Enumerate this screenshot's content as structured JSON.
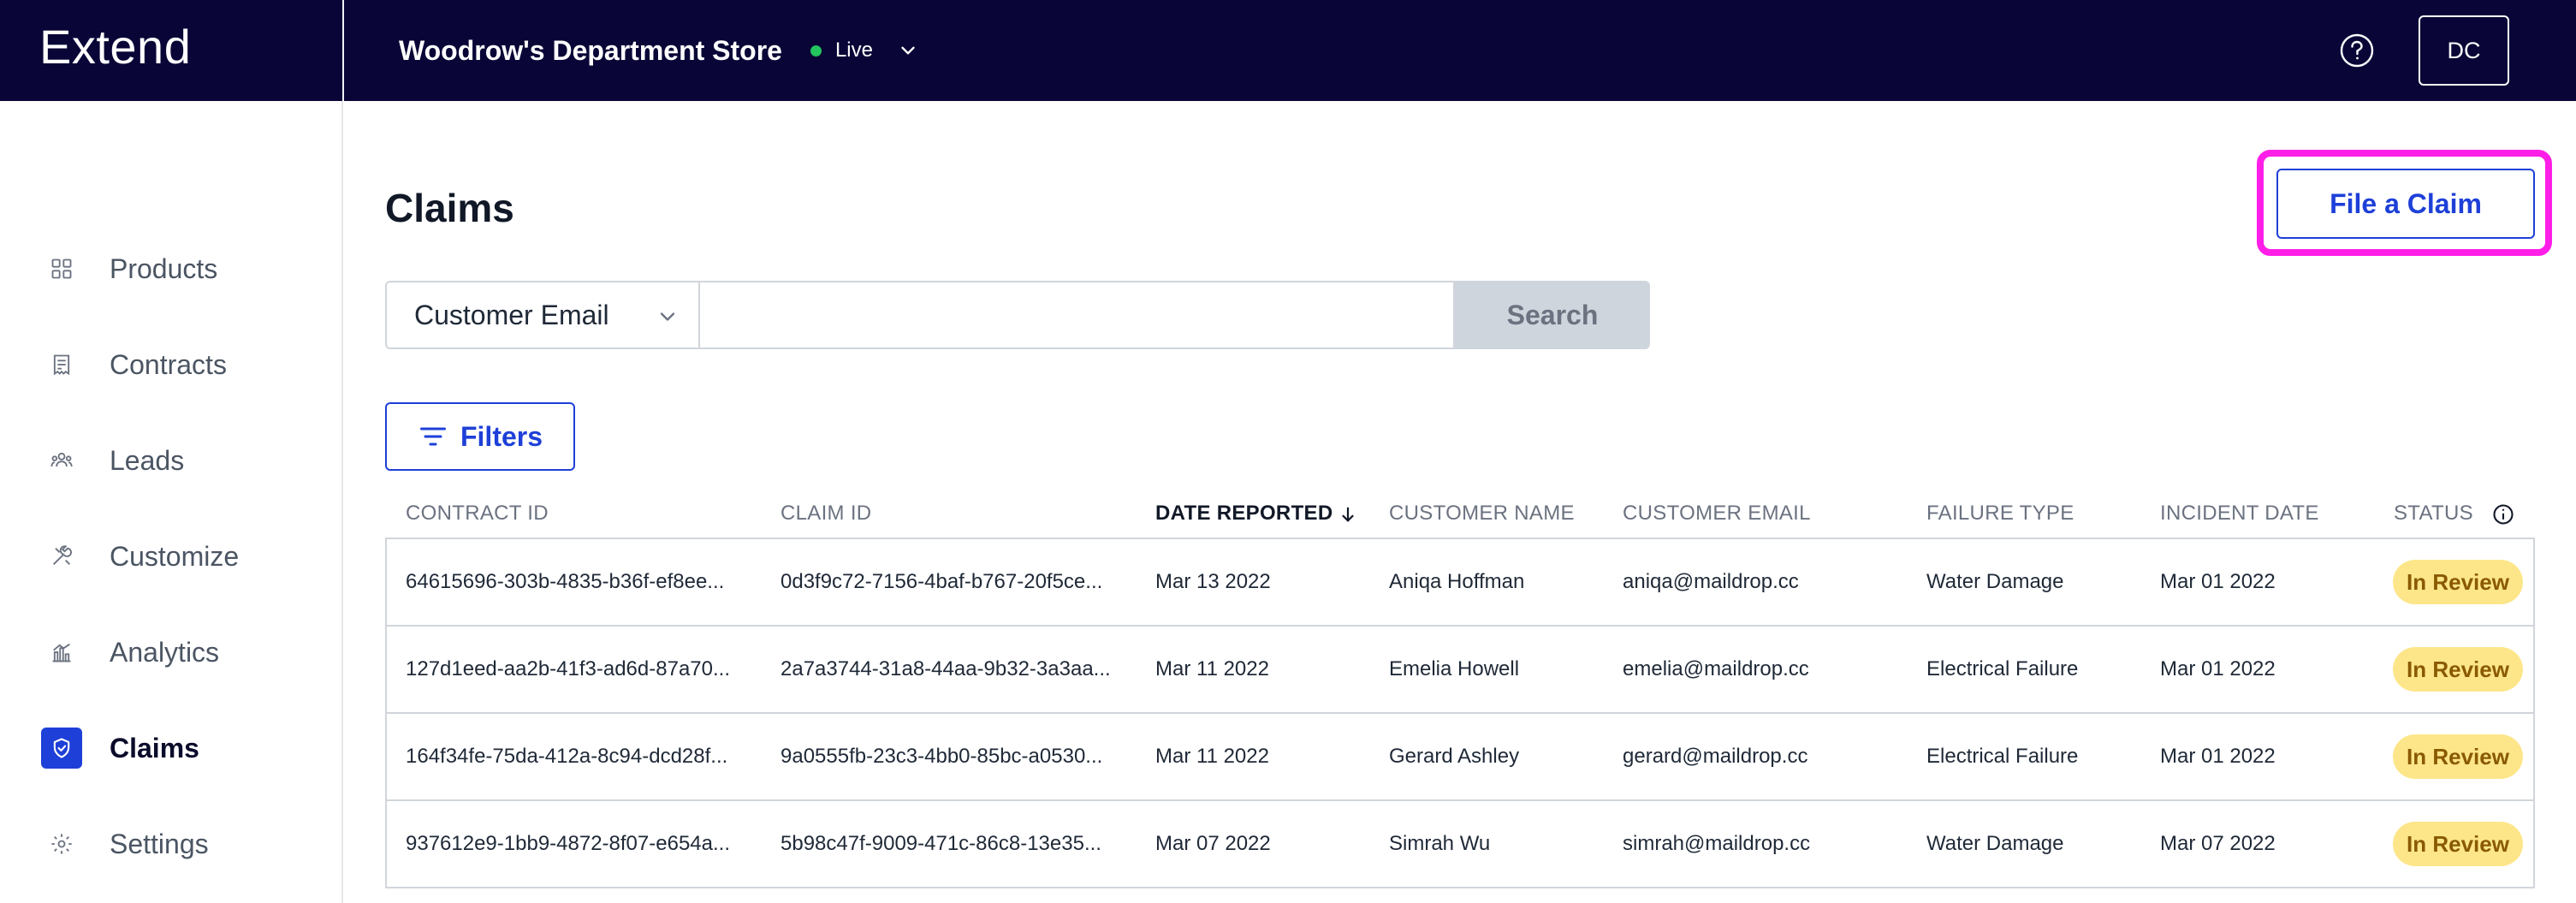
{
  "app": {
    "logo": "Extend"
  },
  "header": {
    "store_name": "Woodrow's Department Store",
    "status_label": "Live",
    "avatar_initials": "DC"
  },
  "sidebar": {
    "items": [
      {
        "label": "Products",
        "icon": "grid-icon"
      },
      {
        "label": "Contracts",
        "icon": "receipt-icon"
      },
      {
        "label": "Leads",
        "icon": "people-icon"
      },
      {
        "label": "Customize",
        "icon": "tools-icon"
      },
      {
        "label": "Analytics",
        "icon": "bar-chart-icon"
      },
      {
        "label": "Claims",
        "icon": "shield-icon",
        "active": true
      },
      {
        "label": "Settings",
        "icon": "gear-icon"
      }
    ]
  },
  "main": {
    "title": "Claims",
    "file_claim_label": "File a Claim",
    "search": {
      "field_selected": "Customer Email",
      "input_value": "",
      "button_label": "Search"
    },
    "filters_label": "Filters",
    "table": {
      "columns": [
        "CONTRACT ID",
        "CLAIM ID",
        "DATE REPORTED",
        "CUSTOMER NAME",
        "CUSTOMER EMAIL",
        "FAILURE TYPE",
        "INCIDENT DATE",
        "STATUS"
      ],
      "rows": [
        [
          "64615696-303b-4835-b36f-ef8ee...",
          "0d3f9c72-7156-4baf-b767-20f5ce...",
          "Mar 13 2022",
          "Aniqa Hoffman",
          "aniqa@maildrop.cc",
          "Water Damage",
          "Mar 01 2022",
          "In Review"
        ],
        [
          "127d1eed-aa2b-41f3-ad6d-87a70...",
          "2a7a3744-31a8-44aa-9b32-3a3aa...",
          "Mar 11 2022",
          "Emelia Howell",
          "emelia@maildrop.cc",
          "Electrical Failure",
          "Mar 01 2022",
          "In Review"
        ],
        [
          "164f34fe-75da-412a-8c94-dcd28f...",
          "9a0555fb-23c3-4bb0-85bc-a0530...",
          "Mar 11 2022",
          "Gerard Ashley",
          "gerard@maildrop.cc",
          "Electrical Failure",
          "Mar 01 2022",
          "In Review"
        ],
        [
          "937612e9-1bb9-4872-8f07-e654a...",
          "5b98c47f-9009-471c-86c8-13e35...",
          "Mar 07 2022",
          "Simrah Wu",
          "simrah@maildrop.cc",
          "Water Damage",
          "Mar 07 2022",
          "In Review"
        ]
      ]
    }
  },
  "colors": {
    "header_bg": "#090637",
    "accent": "#1e40d8",
    "highlight": "#ff1ee8",
    "live": "#22c55e",
    "badge_bg": "#fde68a",
    "badge_text": "#8a5a00"
  }
}
